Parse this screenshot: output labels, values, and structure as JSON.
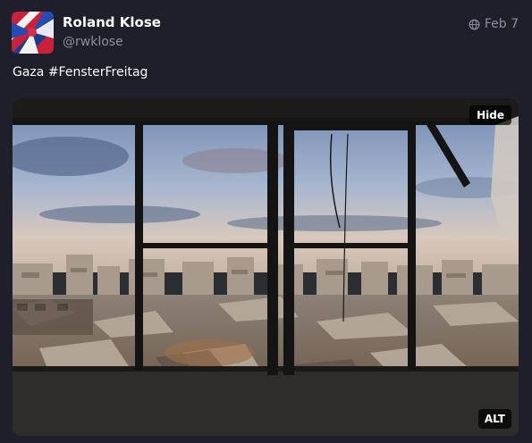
{
  "author": {
    "display_name": "Roland Klose",
    "handle": "@rwklose"
  },
  "meta": {
    "visibility_icon": "globe-icon",
    "date": "Feb 7"
  },
  "content": {
    "text": "Gaza ",
    "hashtag": "#FensterFreitag"
  },
  "media": {
    "hide_label": "Hide",
    "alt_label": "ALT"
  },
  "colors": {
    "background": "#1f1f2b",
    "secondary_text": "#8a8fa3"
  }
}
